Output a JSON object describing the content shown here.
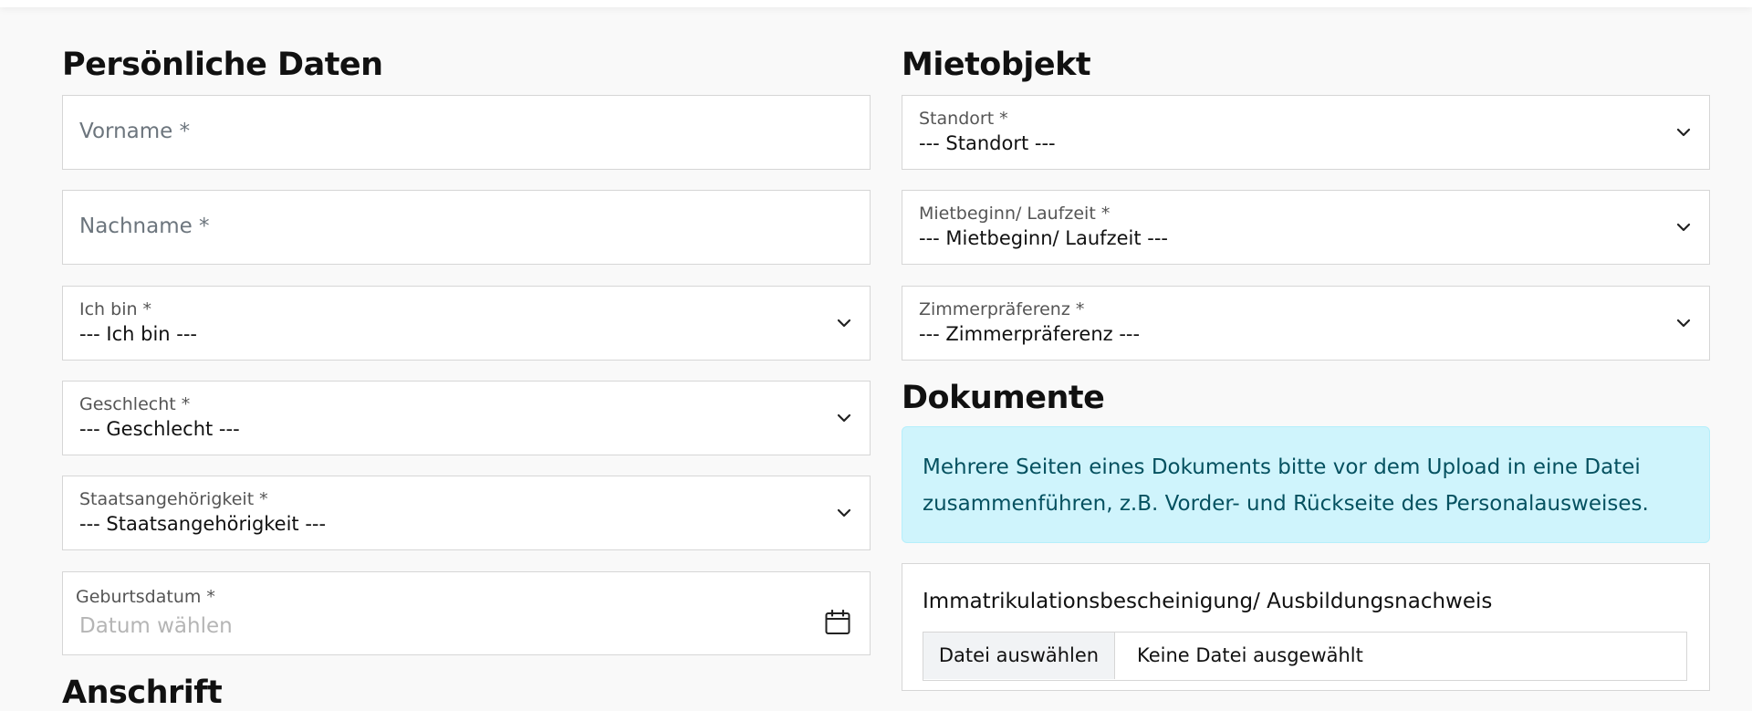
{
  "personal": {
    "heading": "Persönliche Daten",
    "vorname_placeholder": "Vorname *",
    "nachname_placeholder": "Nachname *",
    "ich_bin": {
      "label": "Ich bin *",
      "value": "--- Ich bin ---"
    },
    "geschlecht": {
      "label": "Geschlecht *",
      "value": "--- Geschlecht ---"
    },
    "staatsangehoerigkeit": {
      "label": "Staatsangehörigkeit *",
      "value": "--- Staatsangehörigkeit ---"
    },
    "geburtsdatum": {
      "label": "Geburtsdatum *",
      "placeholder": "Datum wählen"
    }
  },
  "anschrift": {
    "heading": "Anschrift"
  },
  "mietobjekt": {
    "heading": "Mietobjekt",
    "standort": {
      "label": "Standort *",
      "value": "--- Standort ---"
    },
    "mietbeginn": {
      "label": "Mietbeginn/ Laufzeit *",
      "value": "--- Mietbeginn/ Laufzeit ---"
    },
    "zimmer": {
      "label": "Zimmerpräferenz *",
      "value": "--- Zimmerpräferenz ---"
    }
  },
  "dokumente": {
    "heading": "Dokumente",
    "info_line1": "Mehrere Seiten eines Dokuments bitte vor dem Upload in eine Datei",
    "info_line2": "zusammenführen, z.B. Vorder- und Rückseite des Personalausweises.",
    "upload": {
      "title": "Immatrikulationsbescheinigung/ Ausbildungsnachweis",
      "button": "Datei auswählen",
      "status": "Keine Datei ausgewählt"
    }
  },
  "colors": {
    "info_bg": "#cff4fc",
    "info_text": "#055160",
    "border": "#d6d6d6"
  },
  "icons": {
    "select_arrow": "chevron-down-icon",
    "date_picker": "calendar-icon"
  }
}
